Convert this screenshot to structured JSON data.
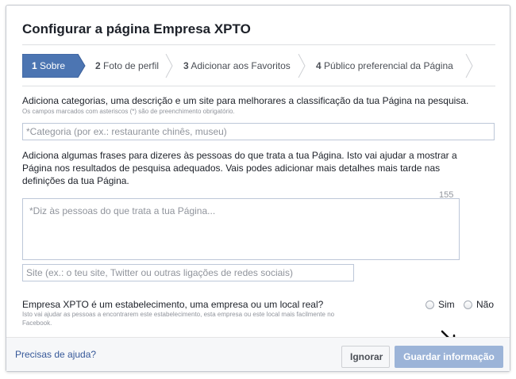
{
  "dialog": {
    "title": "Configurar a página Empresa XPTO"
  },
  "steps": [
    {
      "number": "1",
      "label": "Sobre",
      "active": true
    },
    {
      "number": "2",
      "label": "Foto de perfil",
      "active": false
    },
    {
      "number": "3",
      "label": "Adicionar aos Favoritos",
      "active": false
    },
    {
      "number": "4",
      "label": "Público preferencial da Página",
      "active": false
    }
  ],
  "form": {
    "intro": "Adiciona categorias, uma descrição e um site para melhorares a classificação da tua Página na pesquisa.",
    "required_hint": "Os campos marcados com asteriscos (*) são de preenchimento obrigatório.",
    "category_placeholder": "*Categoria (por ex.: restaurante chinês, museu)",
    "description_help": "Adiciona algumas frases para dizeres às pessoas do que trata a tua Página. Isto vai ajudar a mostrar a Página nos resultados de pesquisa adequados. Vais podes adicionar mais detalhes mais tarde nas definições da tua Página.",
    "char_counter": "155",
    "description_placeholder": "*Diz às pessoas do que trata a tua Página...",
    "website_placeholder": "Site (ex.: o teu site, Twitter ou outras ligações de redes sociais)",
    "establishment_question": "Empresa XPTO é um estabelecimento, uma empresa ou um local real?",
    "establishment_hint": "Isto vai ajudar as pessoas a encontrarem este estabelecimento, esta empresa ou este local mais facilmente no Facebook.",
    "radio_yes": "Sim",
    "radio_no": "Não"
  },
  "footer": {
    "help_link": "Precisas de ajuda?",
    "cancel_label": "Ignorar",
    "save_label": "Guardar informação"
  },
  "colors": {
    "active_step": "#4c75b2",
    "link": "#365899",
    "save_disabled": "#9cb4d8"
  }
}
